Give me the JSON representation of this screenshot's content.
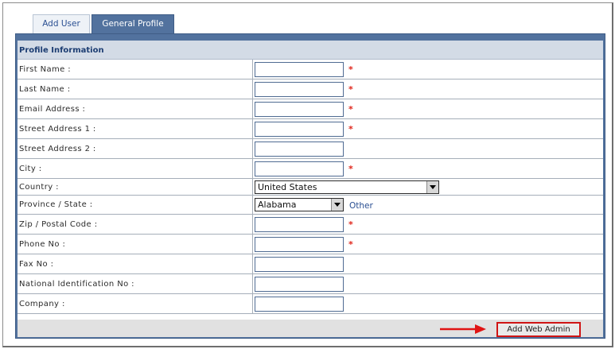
{
  "tabs": [
    {
      "label": "Add User"
    },
    {
      "label": "General Profile"
    }
  ],
  "section": {
    "title": "Profile Information"
  },
  "fields": [
    {
      "label": "First Name :"
    },
    {
      "label": "Last Name :"
    },
    {
      "label": "Email Address :"
    },
    {
      "label": "Street Address 1 :"
    },
    {
      "label": "Street Address 2 :"
    },
    {
      "label": "City :"
    },
    {
      "label": "Country :",
      "value": "United States"
    },
    {
      "label": "Province / State :",
      "value": "Alabama",
      "link": "Other"
    },
    {
      "label": "Zip / Postal Code :"
    },
    {
      "label": "Phone No :"
    },
    {
      "label": "Fax No :"
    },
    {
      "label": "National Identification No :"
    },
    {
      "label": "Company :"
    }
  ],
  "required_mark": "*",
  "submit": {
    "label": "Add Web Admin"
  },
  "colors": {
    "accent": "#52729e",
    "required": "#e0261b",
    "highlight": "#d01414"
  }
}
